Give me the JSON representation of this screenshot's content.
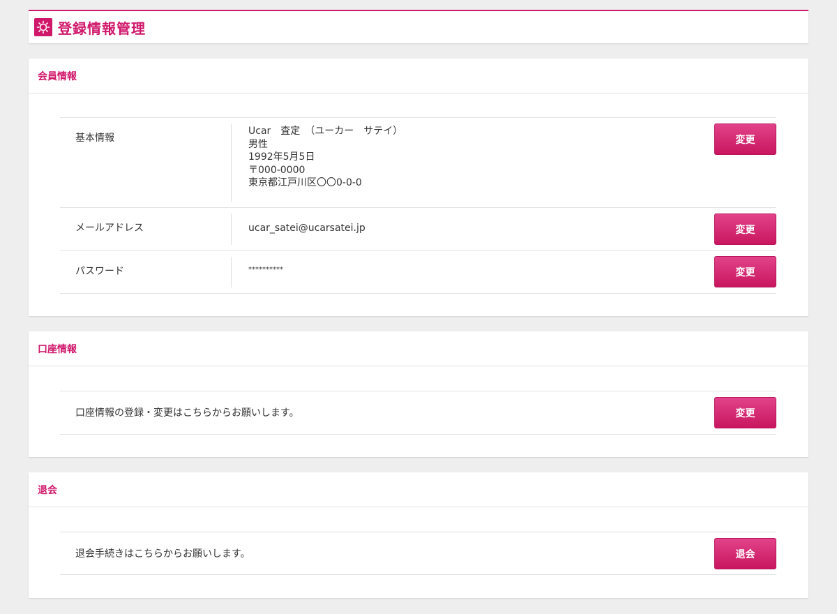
{
  "header": {
    "title": "登録情報管理",
    "accent": "#d0186b"
  },
  "member": {
    "title": "会員情報",
    "basic": {
      "label": "基本情報",
      "lines": [
        "Ucar　査定　（ユーカー　サテイ）",
        "男性",
        "1992年5月5日",
        "〒000-0000",
        "東京都江戸川区〇〇0-0-0"
      ],
      "button": "変更"
    },
    "email": {
      "label": "メールアドレス",
      "value": "ucar_satei@ucarsatei.jp",
      "button": "変更"
    },
    "password": {
      "label": "パスワード",
      "value": "**********",
      "button": "変更"
    }
  },
  "account": {
    "title": "口座情報",
    "text": "口座情報の登録・変更はこちらからお願いします。",
    "button": "変更"
  },
  "withdraw": {
    "title": "退会",
    "text": "退会手続きはこちらからお願いします。",
    "button": "退会"
  }
}
